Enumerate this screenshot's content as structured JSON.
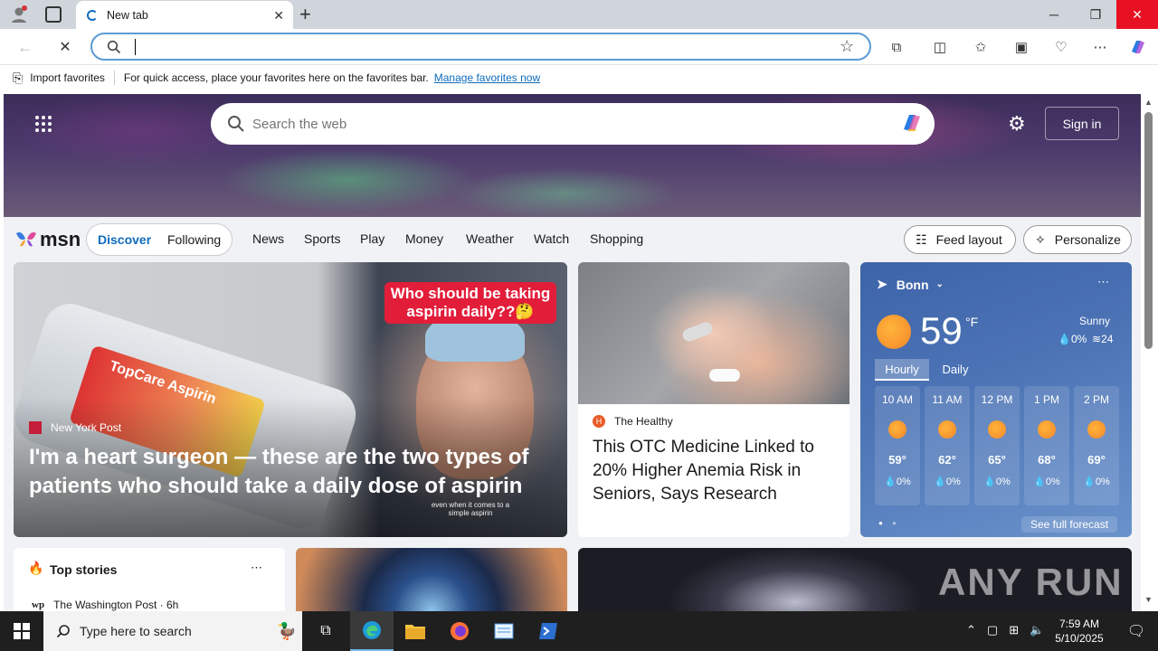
{
  "browser": {
    "tab_title": "New tab",
    "favorites": {
      "import_label": "Import favorites",
      "hint": "For quick access, place your favorites here on the favorites bar.",
      "manage_link": "Manage favorites now"
    }
  },
  "msn": {
    "search_placeholder": "Search the web",
    "sign_in": "Sign in",
    "logo_text": "msn",
    "nav_pill": [
      "Discover",
      "Following"
    ],
    "nav_links": [
      "News",
      "Sports",
      "Play",
      "Money",
      "Weather",
      "Watch",
      "Shopping"
    ],
    "feed_layout": "Feed layout",
    "personalize": "Personalize"
  },
  "hero_story": {
    "overlay_caption": "Who should be taking aspirin daily??🤔",
    "source": "New York Post",
    "title": "I'm a heart surgeon — these are the two types of patients who should take a daily dose of aspirin",
    "bottle_text": "TopCare Aspirin",
    "subtitle_text": "even when it comes to a simple aspirin"
  },
  "story2": {
    "source": "The Healthy",
    "title": "This OTC Medicine Linked to 20% Higher Anemia Risk in Seniors, Says Research"
  },
  "weather": {
    "location": "Bonn",
    "temp": "59",
    "unit": "°F",
    "condition": "Sunny",
    "precip": "0%",
    "wind": "24",
    "tabs": [
      "Hourly",
      "Daily"
    ],
    "hourly": [
      {
        "time": "10 AM",
        "temp": "59°",
        "precip": "0%"
      },
      {
        "time": "11 AM",
        "temp": "62°",
        "precip": "0%"
      },
      {
        "time": "12 PM",
        "temp": "65°",
        "precip": "0%"
      },
      {
        "time": "1 PM",
        "temp": "68°",
        "precip": "0%"
      },
      {
        "time": "2 PM",
        "temp": "69°",
        "precip": "0%"
      }
    ],
    "forecast_link": "See full forecast"
  },
  "top_stories": {
    "title": "Top stories",
    "first_source": "The Washington Post · 6h"
  },
  "watermark": "ANY RUN",
  "taskbar": {
    "search_placeholder": "Type here to search",
    "time": "7:59 AM",
    "date": "5/10/2025"
  },
  "colors": {
    "accent": "#0f6cbd",
    "taskbar": "#1f1f1f",
    "weather_bg": "#4b72b4",
    "caption_red": "#e21d3a"
  }
}
